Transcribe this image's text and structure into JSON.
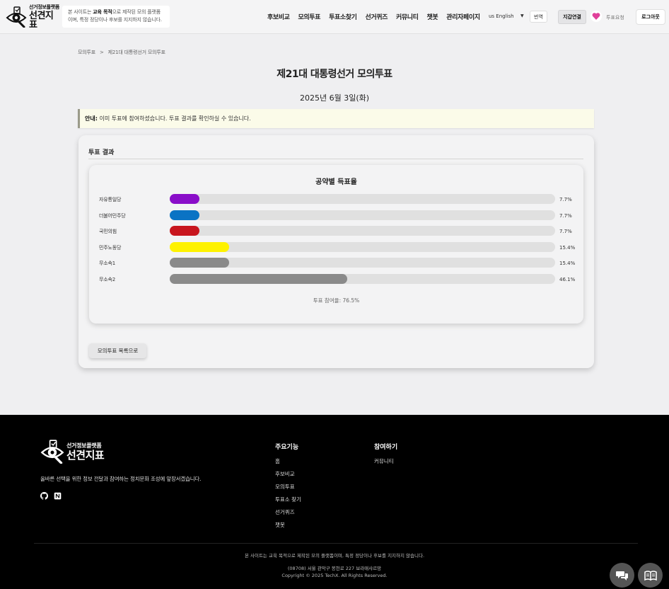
{
  "header": {
    "logo_small": "선거정보플랫폼",
    "logo_big": "선견지표",
    "notice_prefix": "본 사이트는 ",
    "notice_bold": "교육 목적",
    "notice_line1_suffix": "으로 제작된 모의 플랫폼",
    "notice_line2": "이며, 특정 정당이나 후보를 지지하지 않습니다.",
    "nav": [
      "후보비교",
      "모의투표",
      "투표소찾기",
      "선거퀴즈",
      "커뮤니티",
      "챗봇",
      "관리자페이지"
    ],
    "language": "us English",
    "translate_label": "번역",
    "wallet_label": "지갑연결",
    "vote_request_label": "투표요청",
    "logout_label": "로그아웃",
    "icons": {
      "logo": "eye-ballot-icon",
      "caret": "chevron-down-icon",
      "heart": "heart-icon"
    }
  },
  "breadcrumb": {
    "root": "모의투표",
    "separator": ">",
    "current": "제21대 대통령선거 모의투표"
  },
  "page": {
    "title": "제21대 대통령선거 모의투표",
    "date": "2025년 6월 3일(화)"
  },
  "alert": {
    "label": "안내:",
    "text": " 이미 투표에 참여하셨습니다. 투표 결과를 확인하실 수 있습니다."
  },
  "results": {
    "heading": "투표 결과",
    "turnout": "투표 참여율: 76.5%",
    "back_label": "모의투표 목록으로"
  },
  "chart_data": {
    "type": "bar",
    "orientation": "horizontal",
    "title": "공약별 득표율",
    "categories": [
      "자유통일당",
      "더불어민주당",
      "국민의힘",
      "민주노동당",
      "무소속1",
      "무소속2"
    ],
    "values": [
      7.7,
      7.7,
      7.7,
      15.4,
      15.4,
      46.1
    ],
    "value_labels": [
      "7.7%",
      "7.7%",
      "7.7%",
      "15.4%",
      "15.4%",
      "46.1%"
    ],
    "colors": [
      "#8a0ec9",
      "#0a73c4",
      "#c8161e",
      "#fef200",
      "#8a8a8a",
      "#8a8a8a"
    ],
    "xlim": [
      0,
      100
    ],
    "unit": "%"
  },
  "footer": {
    "logo_small": "선거정보플랫폼",
    "logo_big": "선견지표",
    "description": "올바른 선택을 위한 정보 전달과 참여하는 정치문화 조성에 앞장서겠습니다.",
    "social_icons": [
      "github-icon",
      "notion-icon"
    ],
    "main_features_title": "주요기능",
    "main_features": [
      "홈",
      "후보비교",
      "모의투표",
      "투표소 찾기",
      "선거퀴즈",
      "챗봇"
    ],
    "participate_title": "참여하기",
    "participate": [
      "커뮤니티"
    ],
    "disclaimer": "본 사이트는 교육 목적으로 제작된 모의 플랫폼이며, 특정 정당이나 후보를 지지하지 않습니다.",
    "address": "(08708) 서울 관악구 봉천로 227 보라매샤르망",
    "copyright": "Copyright © 2025 TechX. All Rights Reserved."
  },
  "floating": {
    "icons": [
      "chat-icon",
      "book-icon"
    ]
  }
}
